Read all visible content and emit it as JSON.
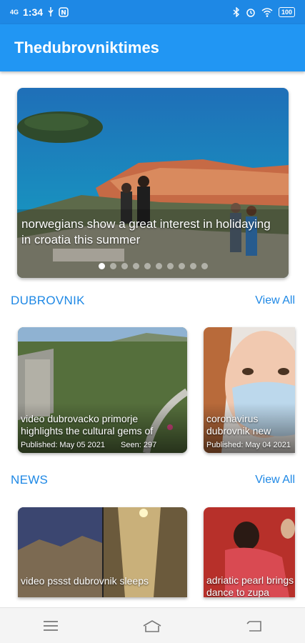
{
  "status_bar": {
    "time": "1:34",
    "signal": "4G",
    "battery": "100"
  },
  "app_bar": {
    "title": "Thedubrovniktimes"
  },
  "carousel": {
    "caption": "norwegians show a great interest in holidaying in croatia this summer",
    "page_count": 10,
    "active_index": 0
  },
  "sections": [
    {
      "title": "DUBROVNIK",
      "view_all": "View All",
      "cards": [
        {
          "caption": "video dubrovacko primorje highlights the cultural gems of",
          "published": "Published: May 05 2021",
          "seen": "Seen: 297"
        },
        {
          "caption": "coronavirus dubrovnik new cases of covid",
          "published": "Published: May 04 2021"
        }
      ]
    },
    {
      "title": "NEWS",
      "view_all": "View All",
      "cards": [
        {
          "caption": "video pssst dubrovnik sleeps"
        },
        {
          "caption": "adriatic pearl brings dance to zupa"
        }
      ]
    }
  ],
  "colors": {
    "primary": "#2196f3",
    "status_bar": "#1e88e5",
    "accent_text": "#1e88e5"
  },
  "icons": [
    "bluetooth-icon",
    "alarm-icon",
    "wifi-icon",
    "battery-icon",
    "menu-icon",
    "home-icon",
    "back-icon"
  ]
}
